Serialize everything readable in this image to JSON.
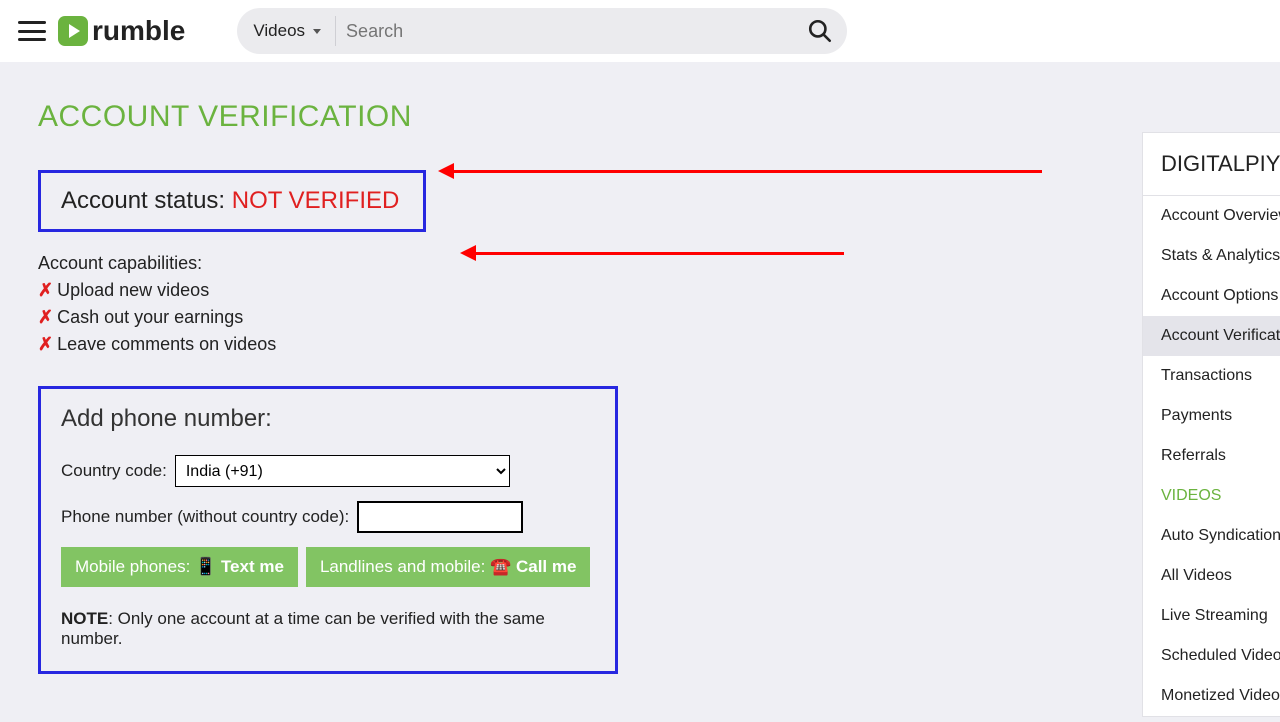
{
  "header": {
    "logo_text": "rumble",
    "videos_dd": "Videos",
    "search_placeholder": "Search"
  },
  "page": {
    "title": "ACCOUNT VERIFICATION",
    "status_label": "Account status: ",
    "status_value": "NOT VERIFIED",
    "caps_heading": "Account capabilities:",
    "caps": {
      "a": "Upload new videos",
      "b": "Cash out your earnings",
      "c": "Leave comments on videos"
    },
    "phone_heading": "Add phone number:",
    "country_label": "Country code:",
    "country_value": "India (+91)",
    "phone_label": "Phone number (without country code):",
    "phone_value": "",
    "btn_text_pre": "Mobile phones: 📱",
    "btn_text_bold": "Text me",
    "btn_call_pre": "Landlines and mobile: ☎️",
    "btn_call_bold": "Call me",
    "note_bold": "NOTE",
    "note_rest": ": Only one account at a time can be verified with the same number."
  },
  "sidebar": {
    "username": "DIGITALPIY",
    "items": {
      "overview": "Account Overview",
      "stats": "Stats & Analytics",
      "options": "Account Options",
      "verification": "Account Verification",
      "transactions": "Transactions",
      "payments": "Payments",
      "referrals": "Referrals",
      "videos_section": "VIDEOS",
      "auto": "Auto Syndication",
      "all": "All Videos",
      "live": "Live Streaming",
      "scheduled": "Scheduled Videos",
      "monetized": "Monetized Videos"
    }
  }
}
